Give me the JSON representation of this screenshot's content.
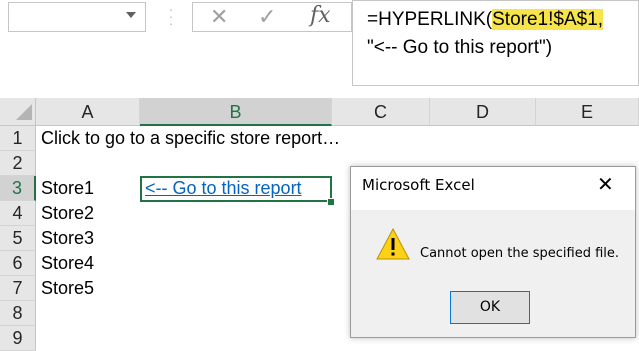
{
  "formula_bar": {
    "name_box_value": "",
    "cancel_icon": "✕",
    "enter_icon": "✓",
    "fx_label": "fx",
    "formula_line1_prefix": "=HYPERLINK(",
    "formula_line1_highlight": "Store1!$A$1,",
    "formula_line2": "\"<-- Go to this report\")"
  },
  "columns": [
    "A",
    "B",
    "C",
    "D",
    "E"
  ],
  "rows": [
    "1",
    "2",
    "3",
    "4",
    "5",
    "6",
    "7",
    "8",
    "9"
  ],
  "cells": {
    "a1": "Click to go to a specific store report…",
    "a3": "Store1",
    "b3": "<-- Go to this report",
    "a4": "Store2",
    "a5": "Store3",
    "a6": "Store4",
    "a7": "Store5"
  },
  "dialog": {
    "title": "Microsoft Excel",
    "close_icon": "✕",
    "message": "Cannot open the specified file.",
    "ok_label": "OK",
    "icon": "warning-icon"
  },
  "colors": {
    "highlight": "#f7e44a",
    "link": "#0563c1",
    "selection": "#217346"
  }
}
